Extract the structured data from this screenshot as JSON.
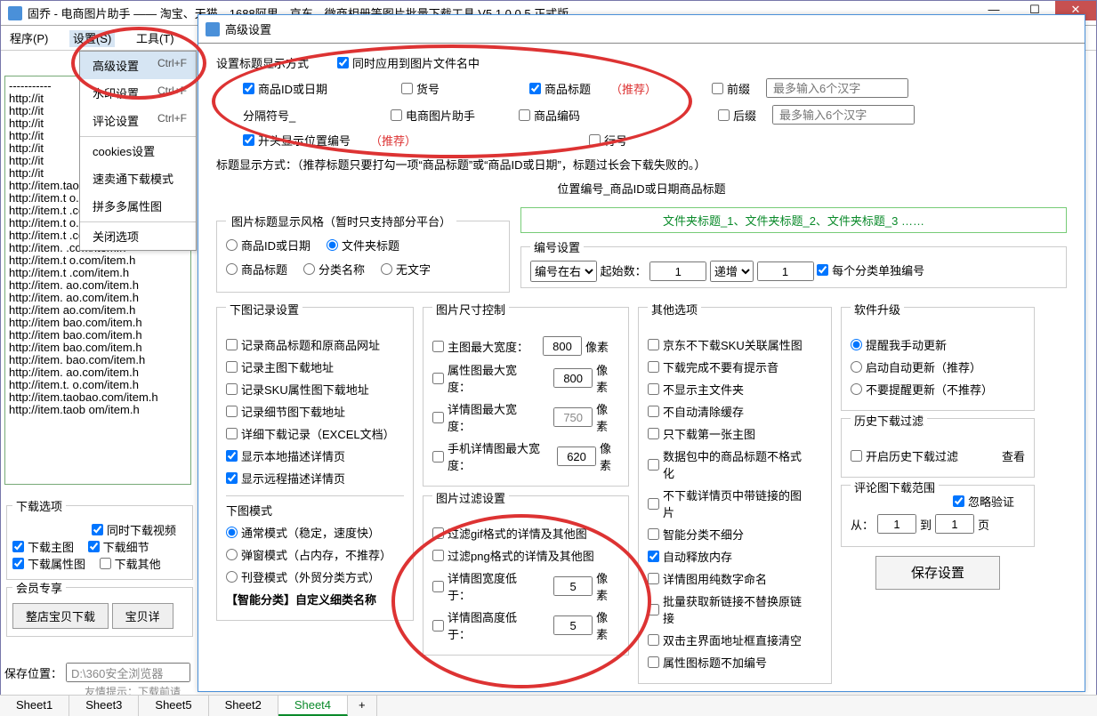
{
  "main": {
    "title": "固乔 - 电商图片助手 —— 淘宝、天猫、1688阿里、京东、微商相册等图片批量下载工具 V5.1.0.0.5 正式版",
    "menu": {
      "program": "程序(P)",
      "settings": "设置(S)",
      "tools": "工具(T)"
    },
    "left_label": "淘宝、",
    "urls": [
      "-----------",
      "http://it",
      "http://it",
      "http://it",
      "http://it",
      "http://it",
      "http://it",
      "http://it",
      "http://item.taobao.com/item.h",
      "http://item.t   o.com/item.h",
      "http://item.t     .com/item.h",
      "http://item.t   o.com/item.h",
      "http://item.t     .com/item.h",
      "http://item.      .com/item.h",
      "http://item.t   o.com/item.h",
      "http://item.t     .com/item.h",
      "http://item.    ao.com/item.h",
      "http://item.    ao.com/item.h",
      "http://item     ao.com/item.h",
      "http://item     bao.com/item.h",
      "http://item     bao.com/item.h",
      "http://item     bao.com/item.h",
      "http://item.    bao.com/item.h",
      "http://item.    ao.com/item.h",
      "http://item.t.   o.com/item.h",
      "http://item.taobao.com/item.h",
      "http://item.taob   om/item.h"
    ],
    "dl_options": {
      "legend": "下载选项",
      "simultaneous": "同时下载视频",
      "main_img": "下载主图",
      "detail": "下载细节",
      "attr_img": "下载属性图",
      "other": "下载其他"
    },
    "member": {
      "legend": "会员专享",
      "whole": "整店宝贝下载",
      "detail": "宝贝详"
    },
    "save": {
      "label": "保存位置：",
      "path": "D:\\360安全浏览器"
    },
    "friend": "友情提示：下载前请"
  },
  "dropdown": {
    "adv_settings": "高级设置",
    "adv_sc": "Ctrl+F",
    "watermark": "水印设置",
    "watermark_sc": "Ctrl+F",
    "comments": "评论设置",
    "comments_sc": "Ctrl+F",
    "cookies": "cookies设置",
    "smt": "速卖通下载模式",
    "multi": "拼多多属性图",
    "close": "关闭选项"
  },
  "dlg": {
    "title": "高级设置",
    "title_display": {
      "legend": "设置标题显示方式",
      "apply_filename": "同时应用到图片文件名中",
      "product_id": "商品ID或日期",
      "sku": "货号",
      "product_title": "商品标题",
      "rec": "（推荐）",
      "prefix": "前缀",
      "suffix": "后缀",
      "hint": "最多输入6个汉字",
      "sep": "分隔符号_",
      "helper": "电商图片助手",
      "code": "商品编码",
      "pos_no": "开头显示位置编号",
      "line_no": "行号",
      "note": "标题显示方式：（推荐标题只要打勾一项“商品标题”或“商品ID或日期”，标题过长会下载失败的。）",
      "preview": "位置编号_商品ID或日期商品标题"
    },
    "img_title_style": {
      "legend": "图片标题显示风格（暂时只支持部分平台）",
      "r1": "商品ID或日期",
      "r2": "文件夹标题",
      "r3": "商品标题",
      "r4": "分类名称",
      "r5": "无文字"
    },
    "number_setting": {
      "legend": "编号设置",
      "pos": "编号在右",
      "start": "起始数：",
      "start_v": "1",
      "mode": "递增",
      "step_v": "1",
      "each": "每个分类单独编号",
      "folder_preview": "文件夹标题_1、文件夹标题_2、文件夹标题_3 ……"
    },
    "record": {
      "legend": "下图记录设置",
      "r1": "记录商品标题和原商品网址",
      "r2": "记录主图下载地址",
      "r3": "记录SKU属性图下载地址",
      "r4": "记录细节图下载地址",
      "r5": "详细下载记录（EXCEL文档）",
      "r6": "显示本地描述详情页",
      "r7": "显示远程描述详情页"
    },
    "mode": {
      "legend": "下图模式",
      "m1": "通常模式（稳定，速度快）",
      "m2": "弹窗模式（占内存，不推荐）",
      "m3": "刊登模式（外贸分类方式）",
      "smart": "【智能分类】自定义细类名称"
    },
    "size": {
      "legend": "图片尺寸控制",
      "s1": "主图最大宽度：",
      "v1": "800",
      "s2": "属性图最大宽度：",
      "v2": "800",
      "s3": "详情图最大宽度：",
      "v3": "750",
      "s4": "手机详情图最大宽度：",
      "v4": "620",
      "px": "像素"
    },
    "filter": {
      "legend": "图片过滤设置",
      "f1": "过滤gif格式的详情及其他图",
      "f2": "过滤png格式的详情及其他图",
      "f3": "详情图宽度低于：",
      "fv3": "5",
      "f4": "详情图高度低于：",
      "fv4": "5",
      "px": "像素"
    },
    "other": {
      "legend": "其他选项",
      "o1": "京东不下载SKU关联属性图",
      "o2": "下载完成不要有提示音",
      "o3": "不显示主文件夹",
      "o4": "不自动清除缓存",
      "o5": "只下载第一张主图",
      "o6": "数据包中的商品标题不格式化",
      "o7": "不下载详情页中带链接的图片",
      "o8": "智能分类不细分",
      "o9": "自动释放内存",
      "o10": "详情图用纯数字命名",
      "o11": "批量获取新链接不替换原链接",
      "o12": "双击主界面地址框直接清空",
      "o13": "属性图标题不加编号"
    },
    "update": {
      "legend": "软件升级",
      "u1": "提醒我手动更新",
      "u2": "启动自动更新（推荐）",
      "u3": "不要提醒更新（不推荐）"
    },
    "history": {
      "legend": "历史下载过滤",
      "h1": "开启历史下载过滤",
      "view": "查看"
    },
    "comment": {
      "legend": "评论图下载范围",
      "ignore": "忽略验证",
      "from": "从：",
      "fv": "1",
      "to": "到",
      "tv": "1",
      "page": "页"
    },
    "save_btn": "保存设置"
  },
  "tabs": [
    "Sheet1",
    "Sheet3",
    "Sheet5",
    "Sheet2",
    "Sheet4"
  ]
}
